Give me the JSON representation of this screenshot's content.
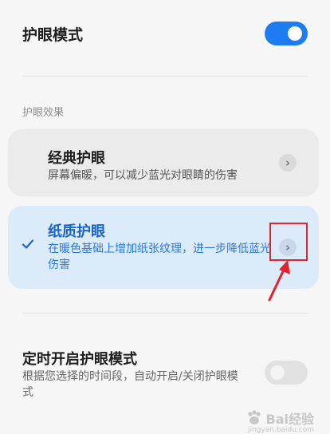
{
  "header": {
    "title": "护眼模式",
    "toggle_on": true
  },
  "section_label": "护眼效果",
  "options": [
    {
      "title": "经典护眼",
      "description": "屏幕偏暖，可以减少蓝光对眼睛的伤害",
      "selected": false
    },
    {
      "title": "纸质护眼",
      "description": "在暖色基础上增加纸张纹理，进一步降低蓝光伤害",
      "selected": true
    }
  ],
  "schedule": {
    "title": "定时开启护眼模式",
    "description": "根据您选择的时间段，自动开启/关闭护眼模式",
    "toggle_on": false
  },
  "watermark": {
    "brand": "Bai经验",
    "sub": "jingyan.baidu.com"
  },
  "colors": {
    "accent": "#1e7cf2",
    "selected_card": "#dcebfa",
    "annotation_red": "#e3232c"
  }
}
